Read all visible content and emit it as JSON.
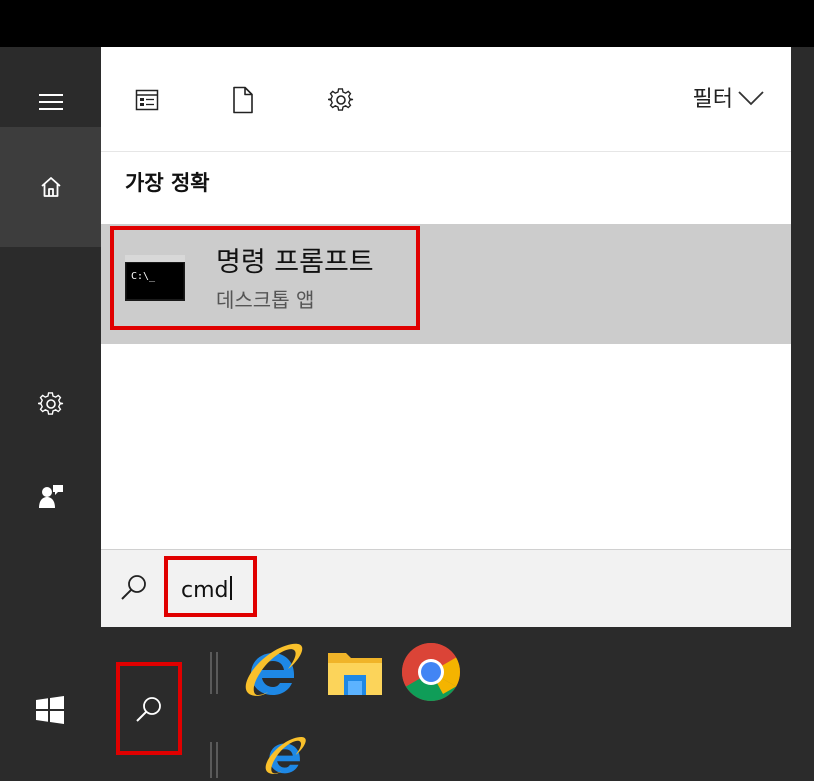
{
  "filter_bar": {
    "icons": [
      "app-list-icon",
      "document-icon",
      "settings-icon"
    ],
    "filter_label": "필터"
  },
  "results": {
    "section_title": "가장 정확",
    "best_match": {
      "title": "명령 프롬프트",
      "subtitle": "데스크톱 앱",
      "icon": "cmd-icon",
      "icon_text": "C:\\_"
    }
  },
  "search": {
    "query": "cmd"
  },
  "rail": {
    "items": [
      "hamburger-icon",
      "home-icon",
      "settings-icon",
      "user-feedback-icon"
    ]
  },
  "taskbar": {
    "items": [
      "windows-start-icon",
      "search-icon",
      "internet-explorer-icon",
      "file-explorer-icon",
      "chrome-icon",
      "internet-explorer-icon"
    ]
  },
  "highlight_color": "#e00000"
}
